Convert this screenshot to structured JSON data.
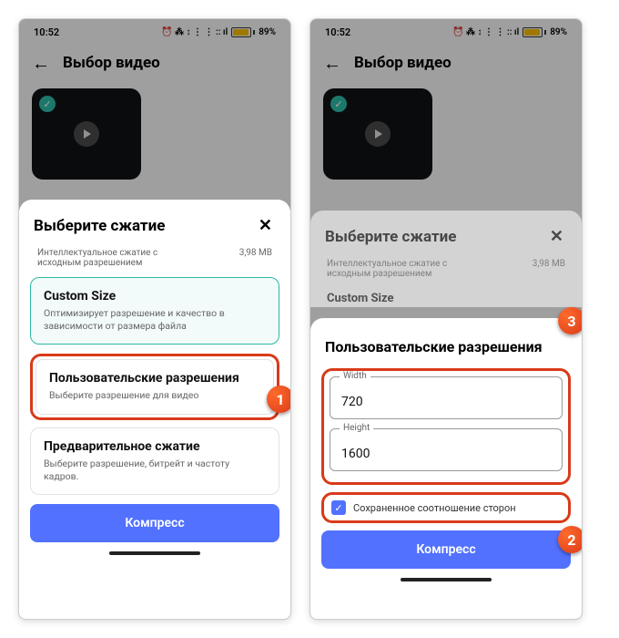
{
  "status": {
    "time": "10:52",
    "icons": "⏰ ⁂ ↕ ⋮ ⋮ :: ıl",
    "battery_pct": "89%"
  },
  "appbar": {
    "title": "Выбор видео"
  },
  "sheet1": {
    "title": "Выберите сжатие",
    "info_text": "Интеллектуальное сжатие с исходным разрешением",
    "info_size": "3,98 MB",
    "opt_custom_title": "Custom Size",
    "opt_custom_desc": "Оптимизирует разрешение и качество в зависимости от размера файла",
    "opt_user_title": "Пользовательские разрешения",
    "opt_user_desc": "Выберите разрешение для видео",
    "opt_pre_title": "Предварительное сжатие",
    "opt_pre_desc": "Выберите разрешение, битрейт и частоту кадров.",
    "btn": "Компресс"
  },
  "sheet2": {
    "info_text": "Интеллектуальное сжатие с исходным разрешением",
    "info_size": "3,98 MB",
    "custom_label": "Custom Size",
    "title": "Пользовательские разрешения",
    "width_label": "Width",
    "width_value": "720",
    "height_label": "Height",
    "height_value": "1600",
    "checkbox_label": "Сохраненное соотношение сторон",
    "btn": "Компресс"
  },
  "badges": {
    "b1": "1",
    "b2": "2",
    "b3": "3"
  }
}
